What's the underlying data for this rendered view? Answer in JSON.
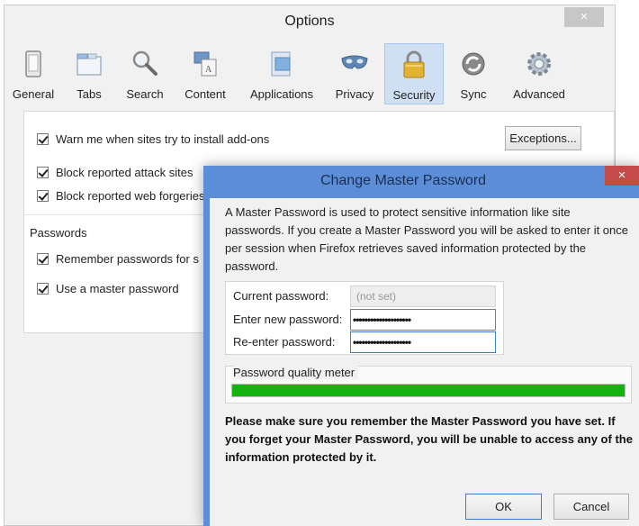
{
  "options_window": {
    "title": "Options",
    "close_glyph": "×",
    "toolbar": [
      {
        "label": "General",
        "icon": "general-icon"
      },
      {
        "label": "Tabs",
        "icon": "tabs-icon"
      },
      {
        "label": "Search",
        "icon": "search-icon"
      },
      {
        "label": "Content",
        "icon": "content-icon"
      },
      {
        "label": "Applications",
        "icon": "applications-icon"
      },
      {
        "label": "Privacy",
        "icon": "privacy-mask-icon"
      },
      {
        "label": "Security",
        "icon": "padlock-icon",
        "selected": true
      },
      {
        "label": "Sync",
        "icon": "sync-icon"
      },
      {
        "label": "Advanced",
        "icon": "gear-icon"
      }
    ],
    "security": {
      "warn_addons": {
        "label": "Warn me when sites try to install add-ons",
        "checked": true
      },
      "exceptions_button": "Exceptions...",
      "block_attack": {
        "label": "Block reported attack sites",
        "checked": true
      },
      "block_forgeries": {
        "label": "Block reported web forgeries",
        "checked": true
      },
      "passwords_heading": "Passwords",
      "remember_passwords": {
        "label": "Remember passwords for s",
        "checked": true
      },
      "use_master": {
        "label": "Use a master password",
        "checked": true
      }
    }
  },
  "dialog": {
    "title": "Change Master Password",
    "close_glyph": "×",
    "intro": "A Master Password is used to protect sensitive information like site passwords. If you create a Master Password you will be asked to enter it once per session when Firefox retrieves saved information protected by the password.",
    "current_label": "Current password:",
    "current_value": "(not set)",
    "new_label": "Enter new password:",
    "new_value": "••••••••••••••••••••",
    "reenter_label": "Re-enter password:",
    "reenter_value": "••••••••••••••••••••",
    "quality_label": "Password quality meter",
    "quality_level": 1.0,
    "warning": "Please make sure you remember the Master Password you have set. If you forget your Master Password, you will be unable to access any of the information protected by it.",
    "ok_label": "OK",
    "cancel_label": "Cancel"
  },
  "colors": {
    "dialog_frame": "#5b8ed6",
    "close_red": "#c74a4a",
    "meter_green": "#14b30f",
    "selected_tab": "#cfe0f4"
  }
}
